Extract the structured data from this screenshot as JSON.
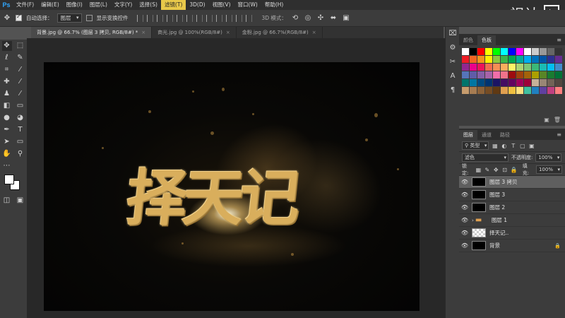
{
  "app": {
    "logo": "Ps"
  },
  "menu": [
    "文件(F)",
    "编辑(E)",
    "图像(I)",
    "图层(L)",
    "文字(Y)",
    "选择(S)",
    "滤镜(T)",
    "3D(D)",
    "视图(V)",
    "窗口(W)",
    "帮助(H)"
  ],
  "menu_active_index": 6,
  "watermark": {
    "text": "视达"
  },
  "options": {
    "auto_select_label": "自动选择：",
    "auto_select_value": "图层",
    "show_transform_label": "显示变换控件",
    "mode_3d_label": "3D 模式："
  },
  "tabs": [
    {
      "label": "背景.jpg @ 66.7% (图层 3 拷贝, RGB/8#) *",
      "active": true
    },
    {
      "label": "商光.jpg @ 100%(RGB/8#)",
      "active": false
    },
    {
      "label": "金粉.jpg @ 66.7%(RGB/8#)",
      "active": false
    }
  ],
  "canvas": {
    "headline": "择天记"
  },
  "swatches": {
    "tabs": [
      "颜色",
      "色板"
    ],
    "active_tab": 1,
    "colors": [
      "#ffffff",
      "#000000",
      "#ff0000",
      "#ffff00",
      "#00ff00",
      "#00ffff",
      "#0000ff",
      "#ff00ff",
      "#ffffff",
      "#cccccc",
      "#999999",
      "#666666",
      "#333333",
      "#ed1c24",
      "#f26522",
      "#f7941d",
      "#fff200",
      "#8dc63f",
      "#39b54a",
      "#00a651",
      "#00a99d",
      "#00aeef",
      "#0072bc",
      "#0054a6",
      "#2e3192",
      "#662d91",
      "#92278f",
      "#ec008c",
      "#ed145b",
      "#f26c4f",
      "#f68e55",
      "#fbaf5d",
      "#fff467",
      "#acd372",
      "#7cc576",
      "#3bb878",
      "#1abbb4",
      "#00bff3",
      "#438ccb",
      "#5574b9",
      "#605ca8",
      "#855fa8",
      "#a763a8",
      "#f06ea9",
      "#f2728b",
      "#9e0b0f",
      "#a0410d",
      "#a3620a",
      "#aba000",
      "#598527",
      "#197b30",
      "#007236",
      "#00746b",
      "#0076a3",
      "#004a80",
      "#003471",
      "#1b1464",
      "#440e62",
      "#630460",
      "#9e005d",
      "#9e0039",
      "#c7b299",
      "#998675",
      "#736357",
      "#534741",
      "#c69c6d",
      "#a67c52",
      "#8c6239",
      "#754c24",
      "#603913",
      "#e0a050",
      "#f0c040",
      "#ffe080",
      "#40c0a0",
      "#2080c0",
      "#6040a0",
      "#c04080",
      "#ff8080"
    ]
  },
  "layers": {
    "tabs": [
      "图层",
      "通道",
      "路径"
    ],
    "active_tab": 0,
    "kind_filter": "类型",
    "blend_mode": "滤色",
    "opacity_label": "不透明度:",
    "opacity_value": "100%",
    "lock_label": "锁定:",
    "fill_label": "填充:",
    "fill_value": "100%",
    "items": [
      {
        "name": "图层 3 拷贝",
        "selected": true,
        "thumb": "dark"
      },
      {
        "name": "图层 3",
        "selected": false,
        "thumb": "dark"
      },
      {
        "name": "图层 2",
        "selected": false,
        "thumb": "dark"
      },
      {
        "name": "图层 1",
        "selected": false,
        "thumb": "folder"
      },
      {
        "name": "择天记..",
        "selected": false,
        "thumb": "checker"
      },
      {
        "name": "背景",
        "selected": false,
        "thumb": "black",
        "locked": true
      }
    ]
  }
}
